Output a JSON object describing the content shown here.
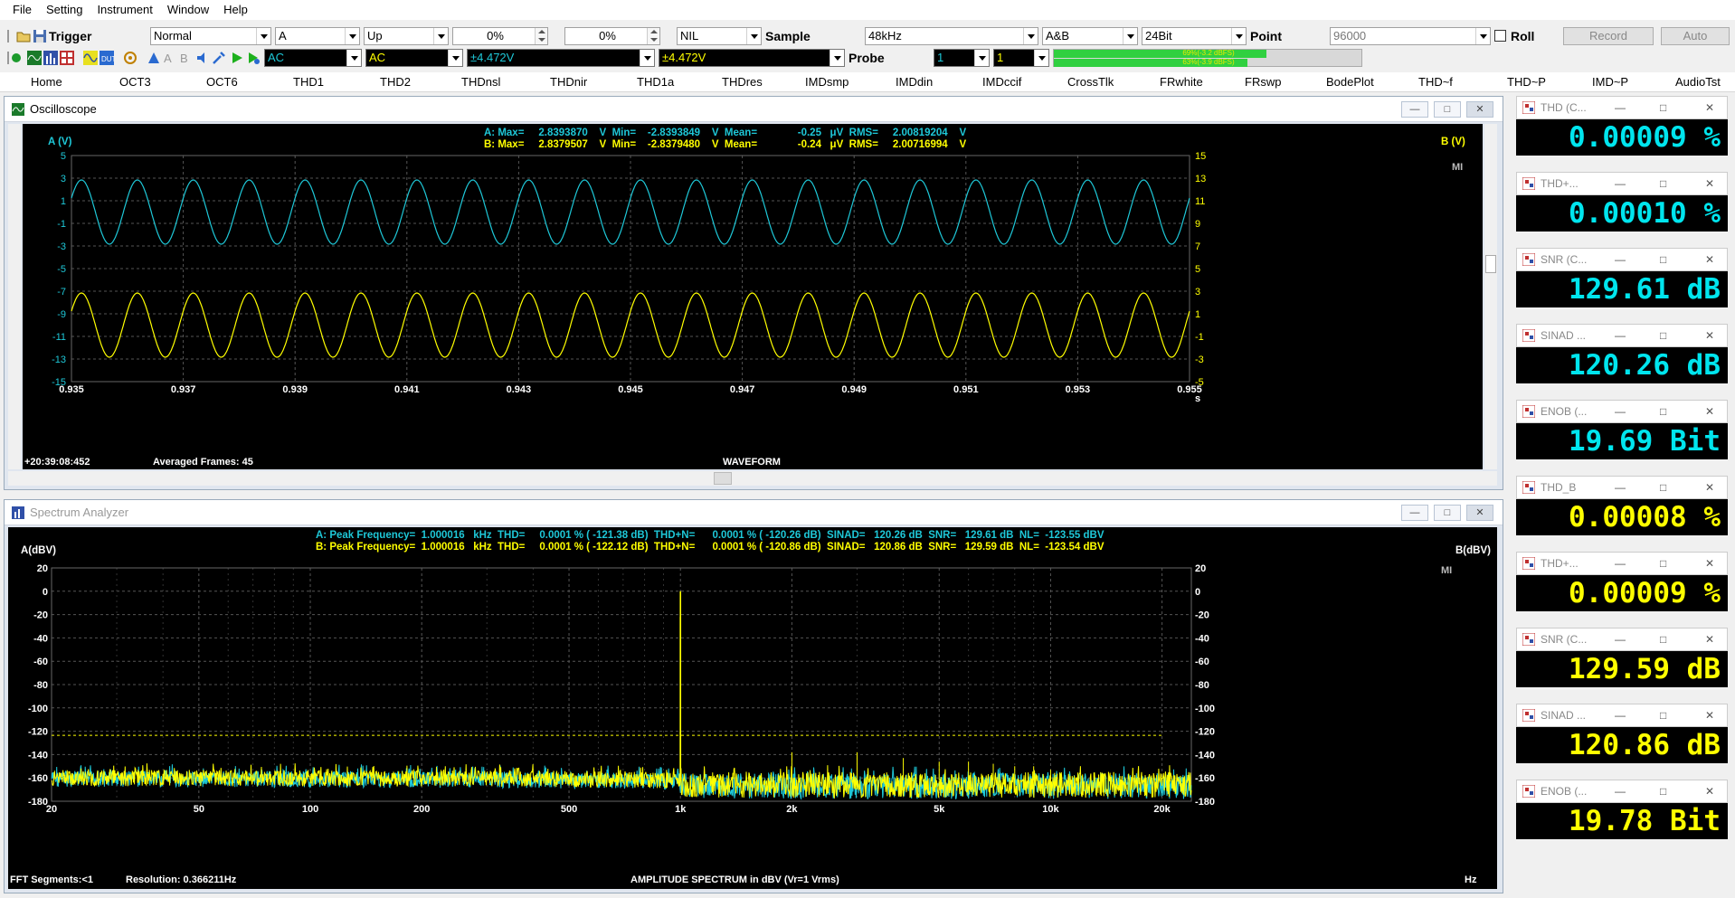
{
  "menu": [
    "File",
    "Setting",
    "Instrument",
    "Window",
    "Help"
  ],
  "toolbar1": {
    "trigger_label": "Trigger",
    "mode": "Normal",
    "channel": "A",
    "edge": "Up",
    "level1": "0%",
    "level2": "0%",
    "nil": "NIL",
    "sample_label": "Sample",
    "sample_rate": "48kHz",
    "ab": "A&B",
    "bits": "24Bit",
    "point_label": "Point",
    "points": "96000",
    "roll_label": "Roll",
    "record_label": "Record",
    "auto_label": "Auto"
  },
  "toolbar2": {
    "coupling_a": "AC",
    "coupling_b": "AC",
    "range_a": "±4.472V",
    "range_b": "±4.472V",
    "probe_label": "Probe",
    "probe_a": "1",
    "probe_b": "1",
    "level_a_text": "69%(-3.2 dBFS)",
    "level_b_text": "63%(-3.9 dBFS)",
    "level_a": 0.69,
    "level_b": 0.63
  },
  "tabs": [
    "Home",
    "OCT3",
    "OCT6",
    "THD1",
    "THD2",
    "THDnsl",
    "THDnir",
    "THD1a",
    "THDres",
    "IMDsmp",
    "IMDdin",
    "IMDccif",
    "CrossTlk",
    "FRwhite",
    "FRswp",
    "BodePlot",
    "THD~f",
    "THD~P",
    "IMD~P",
    "AudioTst"
  ],
  "oscilloscope": {
    "title": "Oscilloscope",
    "stats_a": "A: Max=     2.8393870    V  Min=    -2.8393849    V  Mean=              -0.25   μV  RMS=     2.00819204    V",
    "stats_b": "B: Max=     2.8379507    V  Min=    -2.8379480    V  Mean=              -0.24   μV  RMS=     2.00716994    V",
    "left_axis_label": "A (V)",
    "right_axis_label": "B (V)",
    "left_ticks": [
      "5",
      "3",
      "1",
      "-1",
      "-3",
      "-5",
      "-7",
      "-9",
      "-11",
      "-13",
      "-15"
    ],
    "right_ticks": [
      "15",
      "13",
      "11",
      "9",
      "7",
      "5",
      "3",
      "1",
      "-1",
      "-3",
      "-5"
    ],
    "x_ticks": [
      "0.935",
      "0.937",
      "0.939",
      "0.941",
      "0.943",
      "0.945",
      "0.947",
      "0.949",
      "0.951",
      "0.953",
      "0.955"
    ],
    "x_unit": "s",
    "timestamp": "+20:39:08:452",
    "averaged": "Averaged Frames: 45",
    "x_title": "WAVEFORM",
    "mi": "MI"
  },
  "spectrum": {
    "title": "Spectrum Analyzer",
    "line_a": "A: Peak Frequency=  1.000016   kHz  THD=     0.0001 % ( -121.38 dB)  THD+N=      0.0001 % ( -120.26 dB)  SINAD=   120.26 dB  SNR=   129.61 dB  NL=  -123.55 dBV",
    "line_b": "B: Peak Frequency=  1.000016   kHz  THD=     0.0001 % ( -122.12 dB)  THD+N=      0.0001 % ( -120.86 dB)  SINAD=   120.86 dB  SNR=   129.59 dB  NL=  -123.54 dBV",
    "left_axis_label": "A(dBV)",
    "right_axis_label": "B(dBV)",
    "y_ticks": [
      "20",
      "0",
      "-20",
      "-40",
      "-60",
      "-80",
      "-100",
      "-120",
      "-140",
      "-160",
      "-180"
    ],
    "x_ticks": [
      "20",
      "50",
      "100",
      "200",
      "500",
      "1k",
      "2k",
      "5k",
      "10k",
      "20k"
    ],
    "x_unit": "Hz",
    "fft_segments": "FFT Segments:<1",
    "resolution": "Resolution: 0.366211Hz",
    "x_title": "AMPLITUDE SPECTRUM in dBV (Vr=1 Vrms)",
    "mi": "MI"
  },
  "meters": [
    {
      "title": "THD (C...",
      "value": "0.00009 %",
      "color": "#00e5ee"
    },
    {
      "title": "THD+...",
      "value": "0.00010 %",
      "color": "#00e5ee"
    },
    {
      "title": "SNR (C...",
      "value": "129.61 dB",
      "color": "#00e5ee"
    },
    {
      "title": "SINAD ...",
      "value": "120.26 dB",
      "color": "#00e5ee"
    },
    {
      "title": "ENOB (...",
      "value": "19.69 Bit",
      "color": "#00e5ee"
    },
    {
      "title": "THD_B",
      "value": "0.00008 %",
      "color": "#ffff00"
    },
    {
      "title": "THD+...",
      "value": "0.00009 %",
      "color": "#ffff00"
    },
    {
      "title": "SNR (C...",
      "value": "129.59 dB",
      "color": "#ffff00"
    },
    {
      "title": "SINAD ...",
      "value": "120.86 dB",
      "color": "#ffff00"
    },
    {
      "title": "ENOB (...",
      "value": "19.78 Bit",
      "color": "#ffff00"
    }
  ],
  "colors": {
    "channel_a": "#1ec8d8",
    "channel_b": "#ffff00",
    "grid": "#555555"
  }
}
